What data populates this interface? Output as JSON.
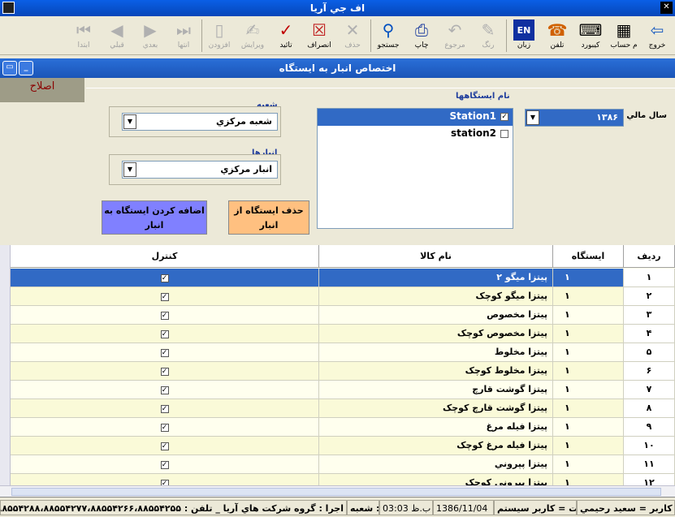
{
  "app_title": "اف جي آريا",
  "toolbar": {
    "buttons": [
      {
        "label": "خروج",
        "icon": "exit-icon",
        "enabled": true
      },
      {
        "label": "م حساب",
        "icon": "calculator-icon",
        "enabled": true
      },
      {
        "label": "کيبورد",
        "icon": "keyboard-icon",
        "enabled": true
      },
      {
        "label": "تلفن",
        "icon": "phone-icon",
        "enabled": true
      },
      {
        "label": "زبان",
        "icon": "language-icon",
        "enabled": true
      },
      {
        "label": "رنگ",
        "icon": "paint-icon",
        "enabled": false
      },
      {
        "label": "مرجوع",
        "icon": "return-icon",
        "enabled": false
      },
      {
        "label": "چاپ",
        "icon": "print-icon",
        "enabled": true
      },
      {
        "label": "جستجو",
        "icon": "search-icon",
        "enabled": true
      },
      {
        "label": "حذف",
        "icon": "delete-icon",
        "enabled": false
      },
      {
        "label": "انصراف",
        "icon": "cancel-icon",
        "enabled": true
      },
      {
        "label": "تائيد",
        "icon": "confirm-icon",
        "enabled": true
      },
      {
        "label": "ويرايش",
        "icon": "edit-icon",
        "enabled": false
      },
      {
        "label": "افزودن",
        "icon": "add-icon",
        "enabled": false
      },
      {
        "label": "انتها",
        "icon": "last-icon",
        "enabled": false
      },
      {
        "label": "بعدي",
        "icon": "next-icon",
        "enabled": false
      },
      {
        "label": "قبلي",
        "icon": "previous-icon",
        "enabled": false
      },
      {
        "label": "ابتدا",
        "icon": "first-icon",
        "enabled": false
      }
    ]
  },
  "window": {
    "title": "اختصاص انبار به ايستگاه",
    "fix_button": "اصلاح"
  },
  "form": {
    "fiscal_year_label": "سال مالي",
    "fiscal_year_value": "۱۳۸۶",
    "stations_label": "نام ايستگاهها",
    "stations": [
      {
        "name": "Station1",
        "checked": true,
        "selected": true
      },
      {
        "name": "station2",
        "checked": false,
        "selected": false
      }
    ],
    "branch_label": "شعبه",
    "branch_value": "شعبه مرکزي",
    "warehouse_label": "انبارها",
    "warehouse_value": "انبار مرکزي",
    "remove_station_button": "حذف ايستگاه از انبار",
    "add_station_button": "اضافه کردن ايستگاه به انبار",
    "colors": {
      "remove_button": "#FFC080",
      "add_button": "#8080FF"
    }
  },
  "grid": {
    "headers": {
      "row": "رديف",
      "station": "ايستگاه",
      "product": "نام کالا",
      "control": "کنترل"
    },
    "rows": [
      {
        "row": "۱",
        "station": "۱",
        "product": "پيتزا ميگو ۲",
        "checked": true
      },
      {
        "row": "۲",
        "station": "۱",
        "product": "پيتزا ميگو کوچک",
        "checked": true
      },
      {
        "row": "۳",
        "station": "۱",
        "product": "پيتزا مخصوص",
        "checked": true
      },
      {
        "row": "۴",
        "station": "۱",
        "product": "پيتزا مخصوص کوچک",
        "checked": true
      },
      {
        "row": "۵",
        "station": "۱",
        "product": "پيتزا مخلوط",
        "checked": true
      },
      {
        "row": "۶",
        "station": "۱",
        "product": "پيتزا مخلوط کوچک",
        "checked": true
      },
      {
        "row": "۷",
        "station": "۱",
        "product": "پيتزا گوشت قارچ",
        "checked": true
      },
      {
        "row": "۸",
        "station": "۱",
        "product": "پيتزا گوشت قارچ کوچک",
        "checked": true
      },
      {
        "row": "۹",
        "station": "۱",
        "product": "پيتزا فيله مرغ",
        "checked": true
      },
      {
        "row": "۱۰",
        "station": "۱",
        "product": "پيتزا فيله مرغ کوچک",
        "checked": true
      },
      {
        "row": "۱۱",
        "station": "۱",
        "product": "پيتزا پپروني",
        "checked": true
      },
      {
        "row": "۱۲",
        "station": "۱",
        "product": "پيتزا پپروني کوچک",
        "checked": true
      }
    ]
  },
  "statusbar": {
    "user": "نام کاربر  = سعيد رحيمي",
    "role": "سمت = کاربر سيستم",
    "date": "1386/11/04",
    "time": "ب.ظ 03:03",
    "branch": "شعبه :",
    "vendor": "اجرا : گروه شرکت هاي آريا _ تلفن : ۸۸۵۵۴۲۸۸،۸۸۵۵۴۲۷۷،۸۸۵۵۴۲۶۶،۸۸۵۵۴۲۵۵"
  }
}
